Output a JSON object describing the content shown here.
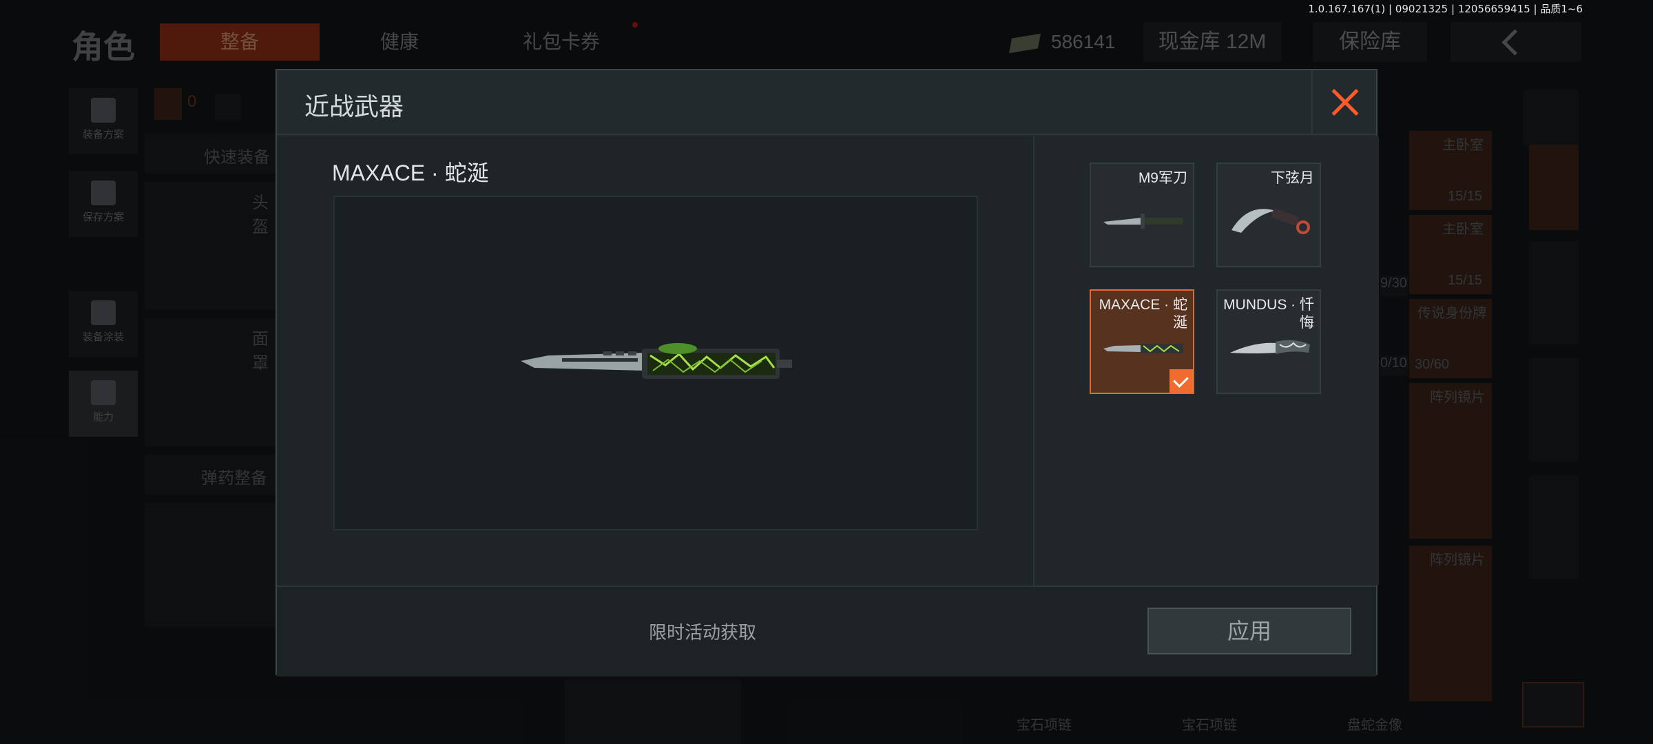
{
  "version_text": "1.0.167.167(1) | 09021325 | 12056659415 | 品质1~6",
  "background": {
    "page_title": "角色",
    "tabs": [
      {
        "label": "整备",
        "active": true
      },
      {
        "label": "健康",
        "active": false
      },
      {
        "label": "礼包卡券",
        "active": false
      }
    ],
    "currency_amount": "586141",
    "cash_vault": "现金库 12M",
    "insurance_vault": "保险库",
    "rail": [
      "装备方案",
      "保存方案",
      "装备涂装",
      "能力"
    ],
    "counter_value": "0",
    "quick_equip": "快速装备",
    "ammo_equip": "弹药整备",
    "left_labels": [
      "头盔",
      "面罩"
    ],
    "right_labels": [
      "主卧室",
      "主卧室",
      "传说身份牌",
      "阵列镜片",
      "阵列镜片"
    ],
    "right_counts": [
      "15/15",
      "15/15",
      "9/30",
      "0/10",
      "30/60"
    ],
    "bottom_labels": [
      "宝石项链",
      "宝石项链",
      "盘蛇金像"
    ]
  },
  "modal": {
    "title": "近战武器",
    "close_icon": "close-icon",
    "selected_weapon_name": "MAXACE · 蛇涎",
    "weapons": [
      {
        "name": "M9军刀",
        "selected": false
      },
      {
        "name": "下弦月",
        "selected": false
      },
      {
        "name": "MAXACE · 蛇涎",
        "selected": true
      },
      {
        "name": "MUNDUS · 忏悔",
        "selected": false
      }
    ],
    "footer_note": "限时活动获取",
    "apply_label": "应用"
  },
  "colors": {
    "accent": "#f06b2e",
    "close": "#ff5b2a",
    "selected_bg": "#57321f"
  }
}
